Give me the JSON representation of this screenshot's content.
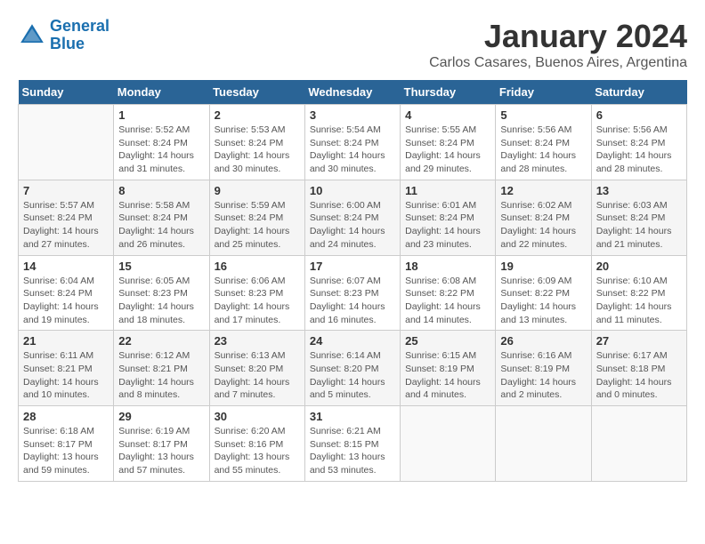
{
  "header": {
    "logo_line1": "General",
    "logo_line2": "Blue",
    "month_title": "January 2024",
    "subtitle": "Carlos Casares, Buenos Aires, Argentina"
  },
  "days_of_week": [
    "Sunday",
    "Monday",
    "Tuesday",
    "Wednesday",
    "Thursday",
    "Friday",
    "Saturday"
  ],
  "weeks": [
    [
      {
        "num": "",
        "info": ""
      },
      {
        "num": "1",
        "info": "Sunrise: 5:52 AM\nSunset: 8:24 PM\nDaylight: 14 hours\nand 31 minutes."
      },
      {
        "num": "2",
        "info": "Sunrise: 5:53 AM\nSunset: 8:24 PM\nDaylight: 14 hours\nand 30 minutes."
      },
      {
        "num": "3",
        "info": "Sunrise: 5:54 AM\nSunset: 8:24 PM\nDaylight: 14 hours\nand 30 minutes."
      },
      {
        "num": "4",
        "info": "Sunrise: 5:55 AM\nSunset: 8:24 PM\nDaylight: 14 hours\nand 29 minutes."
      },
      {
        "num": "5",
        "info": "Sunrise: 5:56 AM\nSunset: 8:24 PM\nDaylight: 14 hours\nand 28 minutes."
      },
      {
        "num": "6",
        "info": "Sunrise: 5:56 AM\nSunset: 8:24 PM\nDaylight: 14 hours\nand 28 minutes."
      }
    ],
    [
      {
        "num": "7",
        "info": "Sunrise: 5:57 AM\nSunset: 8:24 PM\nDaylight: 14 hours\nand 27 minutes."
      },
      {
        "num": "8",
        "info": "Sunrise: 5:58 AM\nSunset: 8:24 PM\nDaylight: 14 hours\nand 26 minutes."
      },
      {
        "num": "9",
        "info": "Sunrise: 5:59 AM\nSunset: 8:24 PM\nDaylight: 14 hours\nand 25 minutes."
      },
      {
        "num": "10",
        "info": "Sunrise: 6:00 AM\nSunset: 8:24 PM\nDaylight: 14 hours\nand 24 minutes."
      },
      {
        "num": "11",
        "info": "Sunrise: 6:01 AM\nSunset: 8:24 PM\nDaylight: 14 hours\nand 23 minutes."
      },
      {
        "num": "12",
        "info": "Sunrise: 6:02 AM\nSunset: 8:24 PM\nDaylight: 14 hours\nand 22 minutes."
      },
      {
        "num": "13",
        "info": "Sunrise: 6:03 AM\nSunset: 8:24 PM\nDaylight: 14 hours\nand 21 minutes."
      }
    ],
    [
      {
        "num": "14",
        "info": "Sunrise: 6:04 AM\nSunset: 8:24 PM\nDaylight: 14 hours\nand 19 minutes."
      },
      {
        "num": "15",
        "info": "Sunrise: 6:05 AM\nSunset: 8:23 PM\nDaylight: 14 hours\nand 18 minutes."
      },
      {
        "num": "16",
        "info": "Sunrise: 6:06 AM\nSunset: 8:23 PM\nDaylight: 14 hours\nand 17 minutes."
      },
      {
        "num": "17",
        "info": "Sunrise: 6:07 AM\nSunset: 8:23 PM\nDaylight: 14 hours\nand 16 minutes."
      },
      {
        "num": "18",
        "info": "Sunrise: 6:08 AM\nSunset: 8:22 PM\nDaylight: 14 hours\nand 14 minutes."
      },
      {
        "num": "19",
        "info": "Sunrise: 6:09 AM\nSunset: 8:22 PM\nDaylight: 14 hours\nand 13 minutes."
      },
      {
        "num": "20",
        "info": "Sunrise: 6:10 AM\nSunset: 8:22 PM\nDaylight: 14 hours\nand 11 minutes."
      }
    ],
    [
      {
        "num": "21",
        "info": "Sunrise: 6:11 AM\nSunset: 8:21 PM\nDaylight: 14 hours\nand 10 minutes."
      },
      {
        "num": "22",
        "info": "Sunrise: 6:12 AM\nSunset: 8:21 PM\nDaylight: 14 hours\nand 8 minutes."
      },
      {
        "num": "23",
        "info": "Sunrise: 6:13 AM\nSunset: 8:20 PM\nDaylight: 14 hours\nand 7 minutes."
      },
      {
        "num": "24",
        "info": "Sunrise: 6:14 AM\nSunset: 8:20 PM\nDaylight: 14 hours\nand 5 minutes."
      },
      {
        "num": "25",
        "info": "Sunrise: 6:15 AM\nSunset: 8:19 PM\nDaylight: 14 hours\nand 4 minutes."
      },
      {
        "num": "26",
        "info": "Sunrise: 6:16 AM\nSunset: 8:19 PM\nDaylight: 14 hours\nand 2 minutes."
      },
      {
        "num": "27",
        "info": "Sunrise: 6:17 AM\nSunset: 8:18 PM\nDaylight: 14 hours\nand 0 minutes."
      }
    ],
    [
      {
        "num": "28",
        "info": "Sunrise: 6:18 AM\nSunset: 8:17 PM\nDaylight: 13 hours\nand 59 minutes."
      },
      {
        "num": "29",
        "info": "Sunrise: 6:19 AM\nSunset: 8:17 PM\nDaylight: 13 hours\nand 57 minutes."
      },
      {
        "num": "30",
        "info": "Sunrise: 6:20 AM\nSunset: 8:16 PM\nDaylight: 13 hours\nand 55 minutes."
      },
      {
        "num": "31",
        "info": "Sunrise: 6:21 AM\nSunset: 8:15 PM\nDaylight: 13 hours\nand 53 minutes."
      },
      {
        "num": "",
        "info": ""
      },
      {
        "num": "",
        "info": ""
      },
      {
        "num": "",
        "info": ""
      }
    ]
  ]
}
